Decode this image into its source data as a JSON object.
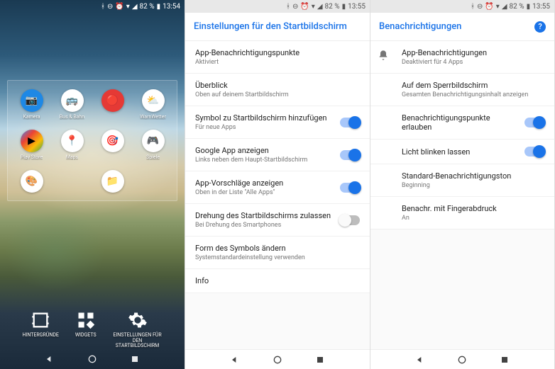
{
  "status": {
    "battery": "82 %",
    "time1": "13:54",
    "time2": "13:55"
  },
  "panel1": {
    "apps": [
      {
        "label": "Kamera",
        "glyph": "📷"
      },
      {
        "label": "Bus & Bahn",
        "glyph": "🚌"
      },
      {
        "label": "",
        "glyph": "🔴"
      },
      {
        "label": "WarnWetter",
        "glyph": "⛅"
      },
      {
        "label": "Play Store",
        "glyph": "▶"
      },
      {
        "label": "Maps",
        "glyph": "📍"
      },
      {
        "label": "",
        "glyph": "🎯"
      },
      {
        "label": "Spiele",
        "glyph": "🎮"
      },
      {
        "label": "",
        "glyph": "🎨"
      },
      {
        "label": "",
        "glyph": ""
      },
      {
        "label": "",
        "glyph": "📁"
      },
      {
        "label": "",
        "glyph": ""
      }
    ],
    "actions": {
      "wallpapers": "HINTERGRÜNDE",
      "widgets": "WIDGETS",
      "settings": "EINSTELLUNGEN FÜR DEN STARTBILDSCHIRM"
    }
  },
  "panel2": {
    "title": "Einstellungen für den Startbildschirm",
    "items": [
      {
        "title": "App-Benachrichtigungspunkte",
        "sub": "Aktiviert",
        "switch": null
      },
      {
        "title": "Überblick",
        "sub": "Oben auf deinem Startbildschirm",
        "switch": null
      },
      {
        "title": "Symbol zu Startbildschirm hinzufügen",
        "sub": "Für neue Apps",
        "switch": true
      },
      {
        "title": "Google App anzeigen",
        "sub": "Links neben dem Haupt-Startbildschirm",
        "switch": true
      },
      {
        "title": "App-Vorschläge anzeigen",
        "sub": "Oben in der Liste \"Alle Apps\"",
        "switch": true
      },
      {
        "title": "Drehung des Startbildschirms zulassen",
        "sub": "Bei Drehung des Smartphones",
        "switch": false
      },
      {
        "title": "Form des Symbols ändern",
        "sub": "Systemstandardeinstellung verwenden",
        "switch": null
      },
      {
        "title": "Info",
        "sub": "",
        "switch": null
      }
    ]
  },
  "panel3": {
    "title": "Benachrichtigungen",
    "items": [
      {
        "title": "App-Benachrichtigungen",
        "sub": "Deaktiviert für 4 Apps",
        "switch": null
      },
      {
        "title": "Auf dem Sperrbildschirm",
        "sub": "Gesamten Benachrichtigungsinhalt anzeigen",
        "switch": null
      },
      {
        "title": "Benachrichtigungspunkte erlauben",
        "sub": "",
        "switch": true
      },
      {
        "title": "Licht blinken lassen",
        "sub": "",
        "switch": true
      },
      {
        "title": "Standard-Benachrichtigungston",
        "sub": "Beginning",
        "switch": null
      },
      {
        "title": "Benachr. mit Fingerabdruck",
        "sub": "An",
        "switch": null
      }
    ]
  }
}
